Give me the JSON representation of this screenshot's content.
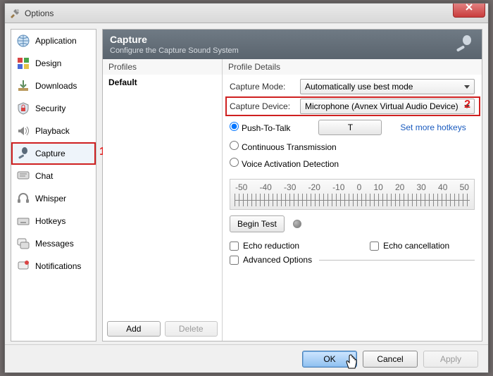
{
  "window": {
    "title": "Options"
  },
  "sidebar": {
    "items": [
      {
        "label": "Application"
      },
      {
        "label": "Design"
      },
      {
        "label": "Downloads"
      },
      {
        "label": "Security"
      },
      {
        "label": "Playback"
      },
      {
        "label": "Capture"
      },
      {
        "label": "Chat"
      },
      {
        "label": "Whisper"
      },
      {
        "label": "Hotkeys"
      },
      {
        "label": "Messages"
      },
      {
        "label": "Notifications"
      }
    ],
    "selected_index": 5
  },
  "annotations": {
    "one": "1",
    "two": "2"
  },
  "header": {
    "title": "Capture",
    "subtitle": "Configure the Capture Sound System"
  },
  "profiles": {
    "heading": "Profiles",
    "items": [
      "Default"
    ],
    "add_label": "Add",
    "delete_label": "Delete"
  },
  "details": {
    "heading": "Profile Details",
    "capture_mode_label": "Capture Mode:",
    "capture_mode_value": "Automatically use best mode",
    "capture_device_label": "Capture Device:",
    "capture_device_value": "Microphone (Avnex Virtual Audio Device)",
    "ptt_label": "Push-To-Talk",
    "ptt_hotkey": "T",
    "set_hotkeys_label": "Set more hotkeys",
    "ct_label": "Continuous Transmission",
    "vad_label": "Voice Activation Detection",
    "scale_ticks": [
      "-50",
      "-40",
      "-30",
      "-20",
      "-10",
      "0",
      "10",
      "20",
      "30",
      "40",
      "50"
    ],
    "begin_test_label": "Begin Test",
    "echo_reduction_label": "Echo reduction",
    "echo_cancel_label": "Echo cancellation",
    "advanced_label": "Advanced Options"
  },
  "footer": {
    "ok": "OK",
    "cancel": "Cancel",
    "apply": "Apply"
  },
  "colors": {
    "highlight": "#cf2020",
    "primary": "#8fc0f0"
  }
}
